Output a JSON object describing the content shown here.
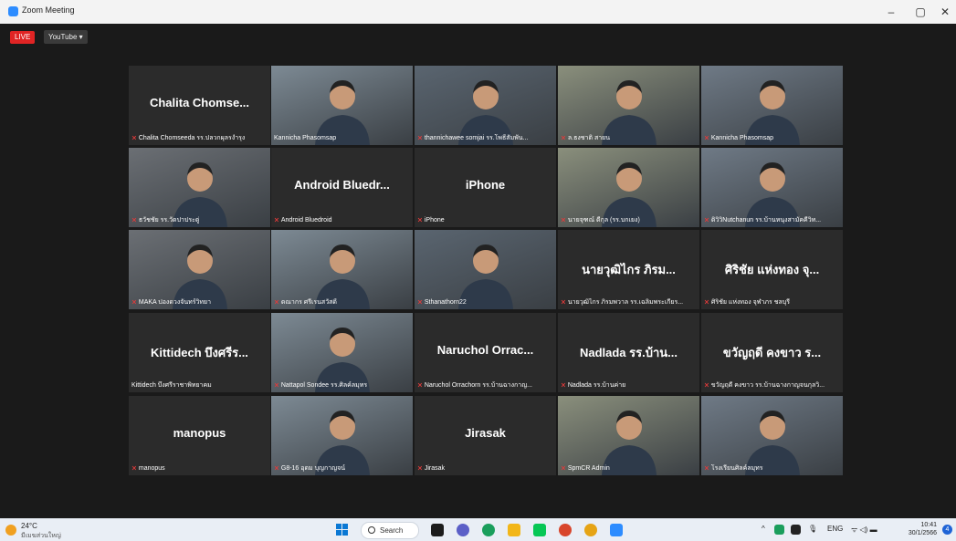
{
  "window": {
    "title": "Zoom Meeting"
  },
  "window_controls": {
    "minimize": "–",
    "restore": "▢",
    "close": "✕"
  },
  "toolbar": {
    "live_badge": "LIVE",
    "stream_target": "YouTube ▾"
  },
  "participants": [
    {
      "display_name": "Chalita Chomse...",
      "caption": "Chalita Chomseeda รร.ปลวกผุลรงำรุง",
      "video": false,
      "muted": true
    },
    {
      "display_name": "",
      "caption": "Kannicha Phasomsap",
      "video": true,
      "muted": false,
      "active_speaker": true
    },
    {
      "display_name": "",
      "caption": "thannichawee somjai รร.โพธิ์สัมพัน...",
      "video": true,
      "muted": true
    },
    {
      "display_name": "",
      "caption": "ล.ธงชาติ สายน",
      "video": true,
      "muted": true
    },
    {
      "display_name": "",
      "caption": "Kannicha Phasomsap",
      "video": true,
      "muted": true
    },
    {
      "display_name": "",
      "caption": "ธวัชชัย รร.วัดปาประดู่",
      "video": true,
      "muted": true
    },
    {
      "display_name": "Android Bluedr...",
      "caption": "Android Bluedroid",
      "video": false,
      "muted": true
    },
    {
      "display_name": "iPhone",
      "caption": "iPhone",
      "video": false,
      "muted": true
    },
    {
      "display_name": "",
      "caption": "นายจุฑณ์ ดีกุล (รร.บกเยง)",
      "video": true,
      "muted": true
    },
    {
      "display_name": "",
      "caption": "ดิวิวิNutchanun รร.บ้านหนุงสามัคคีวิท...",
      "video": true,
      "muted": true
    },
    {
      "display_name": "",
      "caption": "MAKA ปองดวงจันทร์วิทยา",
      "video": true,
      "muted": true
    },
    {
      "display_name": "",
      "caption": "ดณากร ศรีเรนสวัสดิ์",
      "video": true,
      "muted": true
    },
    {
      "display_name": "",
      "caption": "Sthanathorn22",
      "video": true,
      "muted": true
    },
    {
      "display_name": "นายวุฒิไกร ภิรม...",
      "caption": "นายวุฒิไกร ภิรมพวาล รร.เฉลิมพระเกียร...",
      "video": false,
      "muted": true
    },
    {
      "display_name": "ศิริชัย แห่งทอง จุ...",
      "caption": "ศิริชัย แห่งทอง จุฬาภร ชลบุรี",
      "video": false,
      "muted": true
    },
    {
      "display_name": "Kittidech บึงศรีร...",
      "caption": "Kittidech บึงศรีราชาพิทยาคม",
      "video": false,
      "muted": false
    },
    {
      "display_name": "",
      "caption": "Nattapol Sondee รร.ศิลค์ลมุทร",
      "video": true,
      "muted": true
    },
    {
      "display_name": "Naruchol Orrac...",
      "caption": "Naruchol Orrachorn รร.บ้านฉางกาญ...",
      "video": false,
      "muted": true
    },
    {
      "display_name": "Nadlada รร.บ้าน...",
      "caption": "Nadlada รร.บ้านค่าย",
      "video": false,
      "muted": true
    },
    {
      "display_name": "ขวัญฤดี คงขาว ร...",
      "caption": "ขวัญฤดี คงขาว รร.บ้านฉางกาญจนกุลวิ...",
      "video": false,
      "muted": true
    },
    {
      "display_name": "manopus",
      "caption": "manopus",
      "video": false,
      "muted": true
    },
    {
      "display_name": "",
      "caption": "G8-16 อุดม บุญกาญจน์",
      "video": true,
      "muted": true
    },
    {
      "display_name": "Jirasak",
      "caption": "Jirasak",
      "video": false,
      "muted": true
    },
    {
      "display_name": "",
      "caption": "SpmCR Admin",
      "video": true,
      "muted": true
    },
    {
      "display_name": "",
      "caption": "โรงเรียนศิลค์ลมุทร",
      "video": true,
      "muted": true
    }
  ],
  "taskbar": {
    "weather_temp": "24°C",
    "weather_location": "มีเมฆส่วนใหญ่",
    "search_label": "Search",
    "tray_lang": "ENG",
    "tray_icons": "^",
    "tray_sound": "ᯤ ◁) ▬",
    "clock_time": "10:41",
    "clock_date": "30/1/2566",
    "notification_count": "4"
  }
}
